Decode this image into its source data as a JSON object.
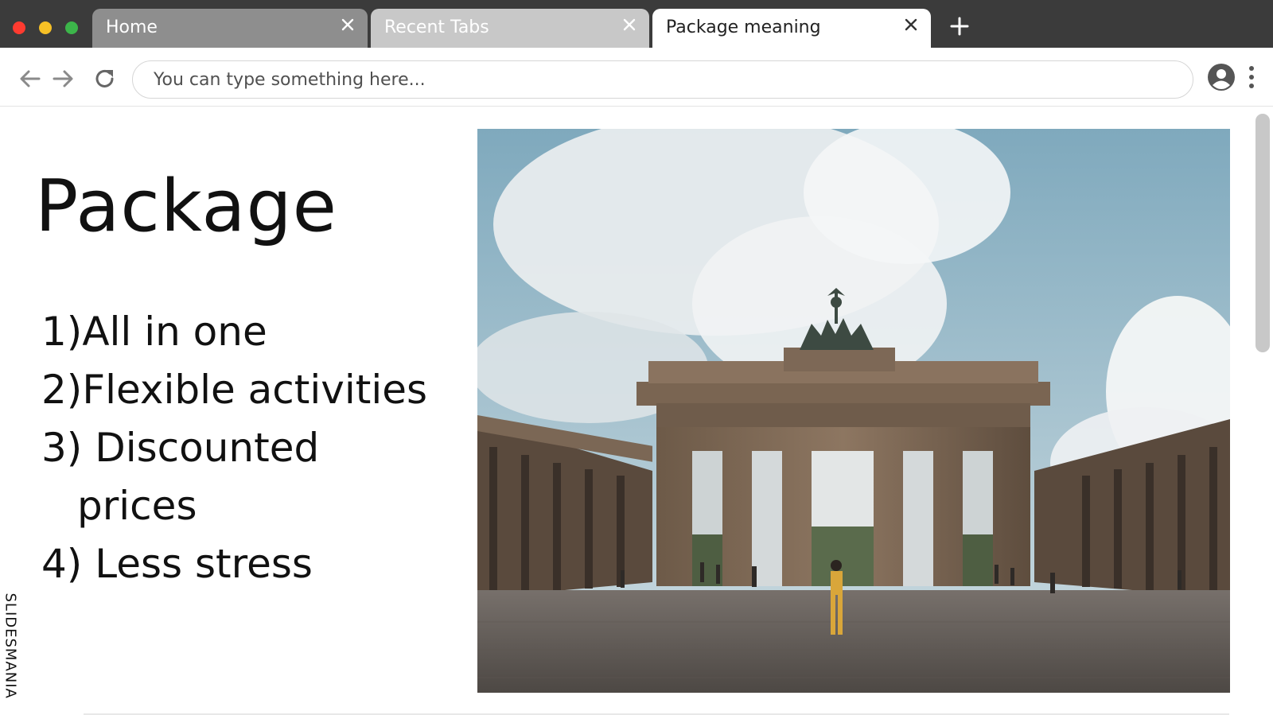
{
  "window": {
    "controls": [
      "close",
      "minimize",
      "maximize"
    ],
    "colors": {
      "close": "#ff3b30",
      "minimize": "#f6c026",
      "maximize": "#3cb54a"
    }
  },
  "tabs": [
    {
      "label": "Home",
      "state": "inactive"
    },
    {
      "label": "Recent Tabs",
      "state": "inactive"
    },
    {
      "label": "Package meaning",
      "state": "active"
    }
  ],
  "toolbar": {
    "address_placeholder": "You can type something here...",
    "icons": [
      "back-arrow-icon",
      "forward-arrow-icon",
      "reload-icon",
      "account-icon",
      "more-menu-icon"
    ]
  },
  "slide": {
    "title": "Package",
    "points": [
      {
        "number": "1)",
        "text": "All in one"
      },
      {
        "number": "2)",
        "text": "Flexible activities"
      },
      {
        "number": "3) ",
        "text": "Discounted",
        "continuation": "prices"
      },
      {
        "number": "4) ",
        "text": "Less stress"
      }
    ],
    "image_subject": "Brandenburg Gate with cloudy sky and person walking on cobblestone square",
    "brand": "SLIDESMANIA"
  }
}
